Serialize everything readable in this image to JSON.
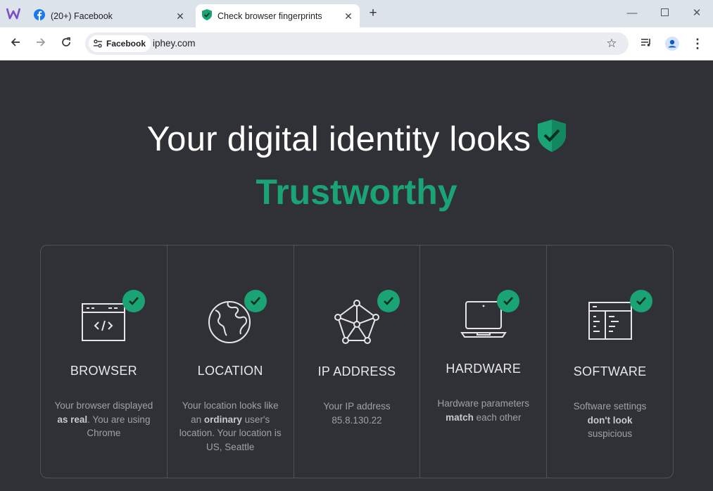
{
  "browser": {
    "tabs": [
      {
        "title": "(20+) Facebook",
        "icon": "facebook-icon",
        "active": false
      },
      {
        "title": "Check browser fingerprints",
        "icon": "shield-icon",
        "active": true
      }
    ],
    "url": "iphey.com",
    "site_chip": "Facebook"
  },
  "hero": {
    "line1": "Your digital identity looks",
    "line2": "Trustworthy",
    "accent_color": "#1aa374"
  },
  "cards": [
    {
      "title": "BROWSER",
      "icon": "browser-code-icon",
      "desc": {
        "p1": "Your browser displayed ",
        "b1": "as real",
        "p2": ". You are using Chrome"
      }
    },
    {
      "title": "LOCATION",
      "icon": "globe-icon",
      "desc": {
        "p1": "Your location looks like an ",
        "b1": "ordinary",
        "p2": " user's location. Your location is US, Seattle"
      }
    },
    {
      "title": "IP ADDRESS",
      "icon": "network-icon",
      "desc": {
        "p1": "Your IP address 85.8.130.22",
        "b1": "",
        "p2": ""
      }
    },
    {
      "title": "HARDWARE",
      "icon": "laptop-icon",
      "desc": {
        "p1": "Hardware parameters ",
        "b1": "match",
        "p2": " each other"
      }
    },
    {
      "title": "SOFTWARE",
      "icon": "software-window-icon",
      "desc": {
        "p1": "Software settings ",
        "b1": "don't look",
        "p2": " suspicious"
      }
    }
  ]
}
